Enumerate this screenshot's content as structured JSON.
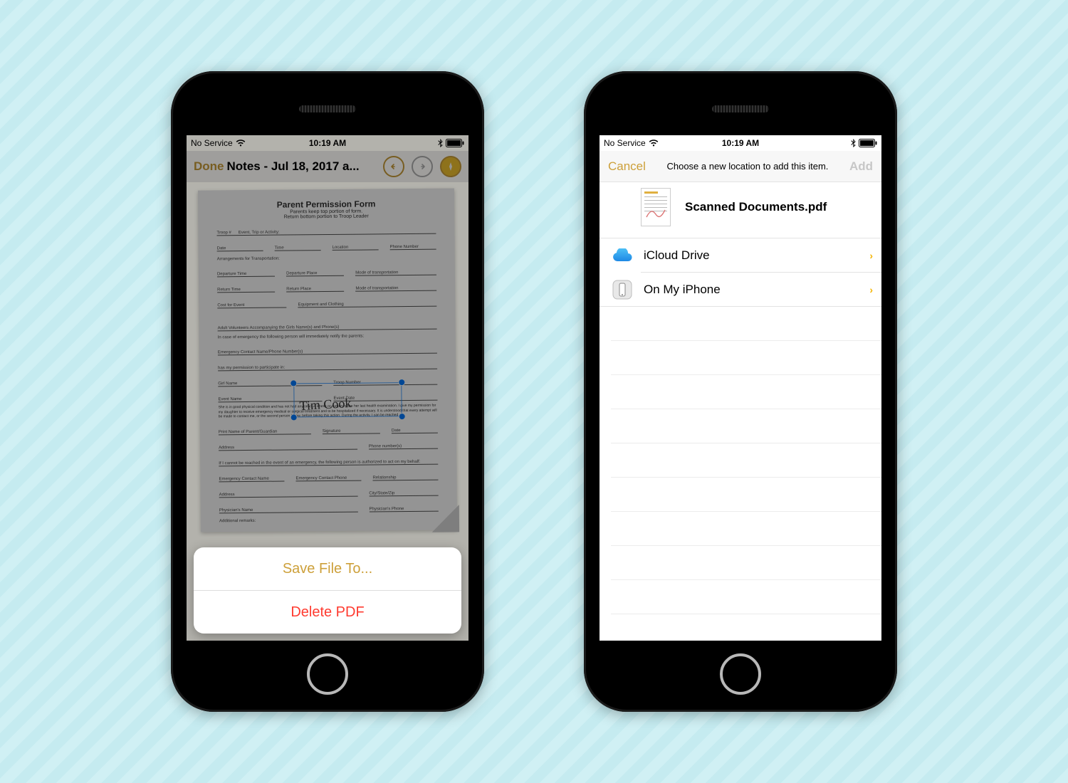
{
  "status": {
    "carrier": "No Service",
    "time": "10:19 AM"
  },
  "phone1": {
    "nav": {
      "done": "Done",
      "title": "Notes - Jul 18, 2017 a..."
    },
    "document": {
      "title": "Parent Permission Form",
      "sub1": "Parents keep top portion of form.",
      "sub2": "Return bottom portion to Troop Leader",
      "troop_label": "Troop #",
      "event_label": "Event, Trip or Activity:",
      "arrangements": "Arrangements for Transportation:",
      "emergency": "In case of emergency the following person will immediately notify the parents:",
      "permission_suffix": "has my permission to participate in:",
      "remarks": "Additional remarks:"
    },
    "actions": {
      "save": "Save File To...",
      "delete": "Delete PDF"
    }
  },
  "phone2": {
    "nav": {
      "cancel": "Cancel",
      "message": "Choose a new location to add this item.",
      "add": "Add"
    },
    "filename": "Scanned Documents.pdf",
    "locations": [
      {
        "label": "iCloud Drive",
        "icon": "cloud"
      },
      {
        "label": "On My iPhone",
        "icon": "iphone"
      }
    ]
  },
  "colors": {
    "accent": "#cda03a",
    "destructive": "#ff3b30",
    "chevron": "#f4b400"
  }
}
